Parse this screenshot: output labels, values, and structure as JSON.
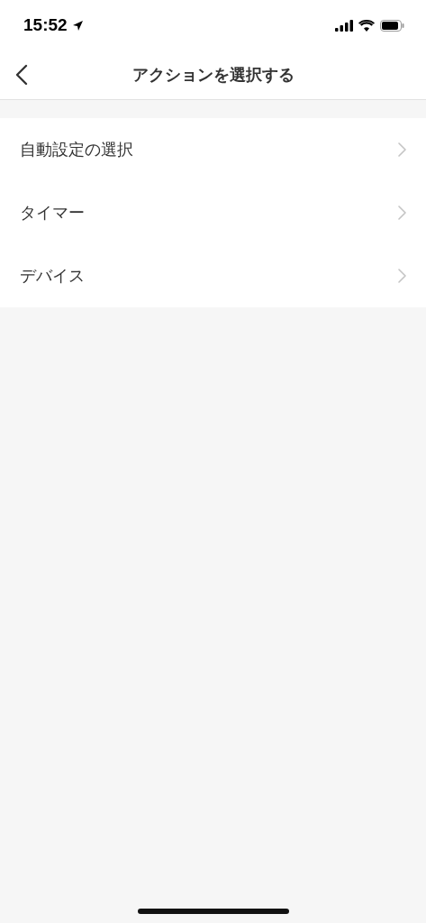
{
  "status_bar": {
    "time": "15:52"
  },
  "nav": {
    "title": "アクションを選択する"
  },
  "items": [
    {
      "label": "自動設定の選択"
    },
    {
      "label": "タイマー"
    },
    {
      "label": "デバイス"
    }
  ]
}
